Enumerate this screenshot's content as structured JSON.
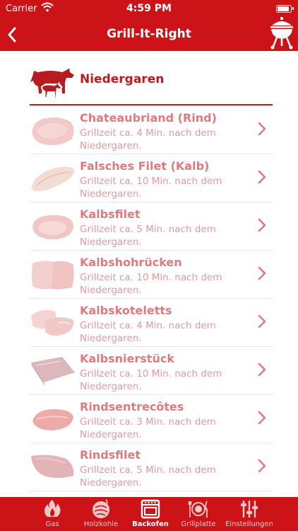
{
  "status": {
    "carrier": "Carrier",
    "time": "4:59 PM"
  },
  "nav": {
    "title": "Grill-It-Right",
    "back_icon": "chevron-left-icon",
    "action_icon": "kettle-grill-icon"
  },
  "section": {
    "title": "Niedergaren",
    "icon": "cow-and-calf-icon"
  },
  "items": [
    {
      "name": "Chateaubriand (Rind)",
      "desc": "Grillzeit ca. 4 Min. nach dem Niedergaren."
    },
    {
      "name": "Falsches Filet (Kalb)",
      "desc": "Grillzeit ca. 10 Min. nach dem Niedergaren."
    },
    {
      "name": "Kalbsfilet",
      "desc": "Grillzeit ca. 5 Min. nach dem Niedergaren."
    },
    {
      "name": "Kalbshohrücken",
      "desc": "Grillzeit ca. 10 Min. nach dem Niedergaren."
    },
    {
      "name": "Kalbskoteletts",
      "desc": "Grillzeit ca. 4 Min. nach dem Niedergaren."
    },
    {
      "name": "Kalbsnierstück",
      "desc": "Grillzeit ca. 10 Min. nach dem Niedergaren."
    },
    {
      "name": "Rindsentrecôtes",
      "desc": "Grillzeit ca. 3 Min. nach dem Niedergaren."
    },
    {
      "name": "Rindsfilet",
      "desc": "Grillzeit ca. 5 Min. nach dem Niedergaren."
    }
  ],
  "tabs": [
    {
      "label": "Gas",
      "icon": "flame-icon"
    },
    {
      "label": "Holzkohle",
      "icon": "charcoal-icon"
    },
    {
      "label": "Backofen",
      "icon": "oven-icon",
      "active": true
    },
    {
      "label": "Grillplatte",
      "icon": "plate-cutlery-icon"
    },
    {
      "label": "Einstellungen",
      "icon": "sliders-icon"
    }
  ],
  "colors": {
    "brand_red": "#cc1418",
    "item_title": "#e17a7e",
    "item_text": "#e7989b"
  }
}
